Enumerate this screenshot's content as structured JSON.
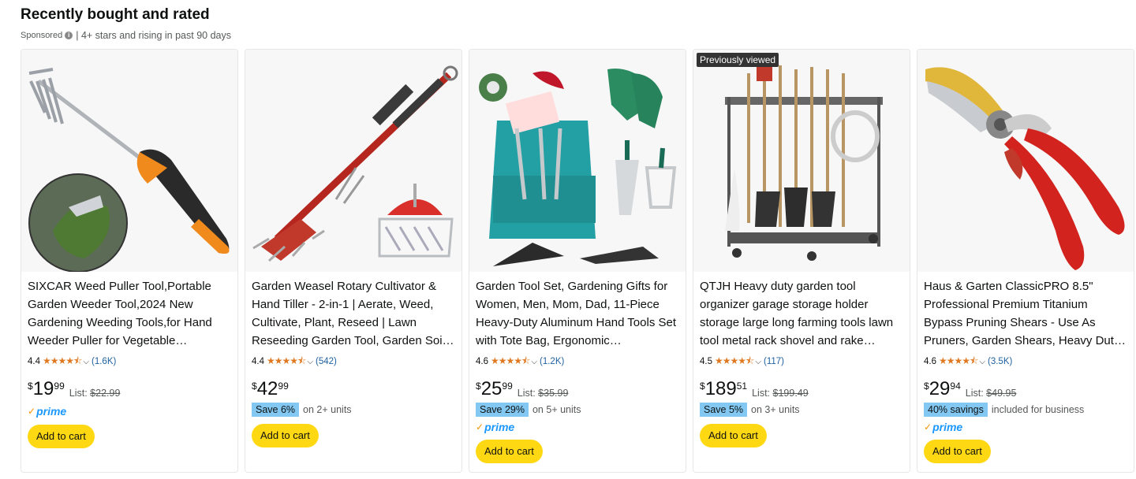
{
  "header": {
    "title": "Recently bought and rated",
    "sponsored": "Sponsored",
    "subtitle": "| 4+ stars and rising in past 90 days"
  },
  "colors": {
    "cart": "#ffd814",
    "star": "#de7921",
    "link": "#2162a1",
    "prime": "#1a98ff",
    "save_badge": "#82c8f2"
  },
  "products": [
    {
      "badge": "",
      "title": "SIXCAR Weed Puller Tool,Portable Garden Weeder Tool,2024 New Gardening Weeding Tools,for Hand Weeder Puller for Vegetable…",
      "rating": "4.4",
      "stars": "★★★★⯪",
      "count": "(1.6K)",
      "currency": "$",
      "whole": "19",
      "fraction": "99",
      "list_label": "List:",
      "list_price": "$22.99",
      "save_badge": "",
      "save_text": "",
      "prime": "prime",
      "cart": "Add to cart"
    },
    {
      "badge": "",
      "title": "Garden Weasel Rotary Cultivator & Hand Tiller - 2-in-1 | Aerate, Weed, Cultivate, Plant, Reseed | Lawn Reseeding Garden Tool, Garden Soi…",
      "rating": "4.4",
      "stars": "★★★★⯪",
      "count": "(542)",
      "currency": "$",
      "whole": "42",
      "fraction": "99",
      "list_label": "",
      "list_price": "",
      "save_badge": "Save 6%",
      "save_text": "on 2+ units",
      "prime": "",
      "cart": "Add to cart"
    },
    {
      "badge": "",
      "title": "Garden Tool Set, Gardening Gifts for Women, Men, Mom, Dad, 11-Piece Heavy-Duty Aluminum Hand Tools Set with Tote Bag, Ergonomic…",
      "rating": "4.6",
      "stars": "★★★★⯪",
      "count": "(1.2K)",
      "currency": "$",
      "whole": "25",
      "fraction": "99",
      "list_label": "List:",
      "list_price": "$35.99",
      "save_badge": "Save 29%",
      "save_text": "on 5+ units",
      "prime": "prime",
      "cart": "Add to cart"
    },
    {
      "badge": "Previously viewed",
      "title": "QTJH Heavy duty garden tool organizer garage storage holder storage large long farming tools lawn tool metal rack shovel and rake…",
      "rating": "4.5",
      "stars": "★★★★⯪",
      "count": "(117)",
      "currency": "$",
      "whole": "189",
      "fraction": "51",
      "list_label": "List:",
      "list_price": "$199.49",
      "save_badge": "Save 5%",
      "save_text": "on 3+ units",
      "prime": "",
      "cart": "Add to cart"
    },
    {
      "badge": "",
      "title": "Haus & Garten ClassicPRO 8.5\" Professional Premium Titanium Bypass Pruning Shears - Use As Pruners, Garden Shears, Heavy Dut…",
      "rating": "4.6",
      "stars": "★★★★⯪",
      "count": "(3.5K)",
      "currency": "$",
      "whole": "29",
      "fraction": "94",
      "list_label": "List:",
      "list_price": "$49.95",
      "save_badge": "40% savings",
      "save_text": "included for business",
      "prime": "prime",
      "cart": "Add to cart"
    }
  ]
}
